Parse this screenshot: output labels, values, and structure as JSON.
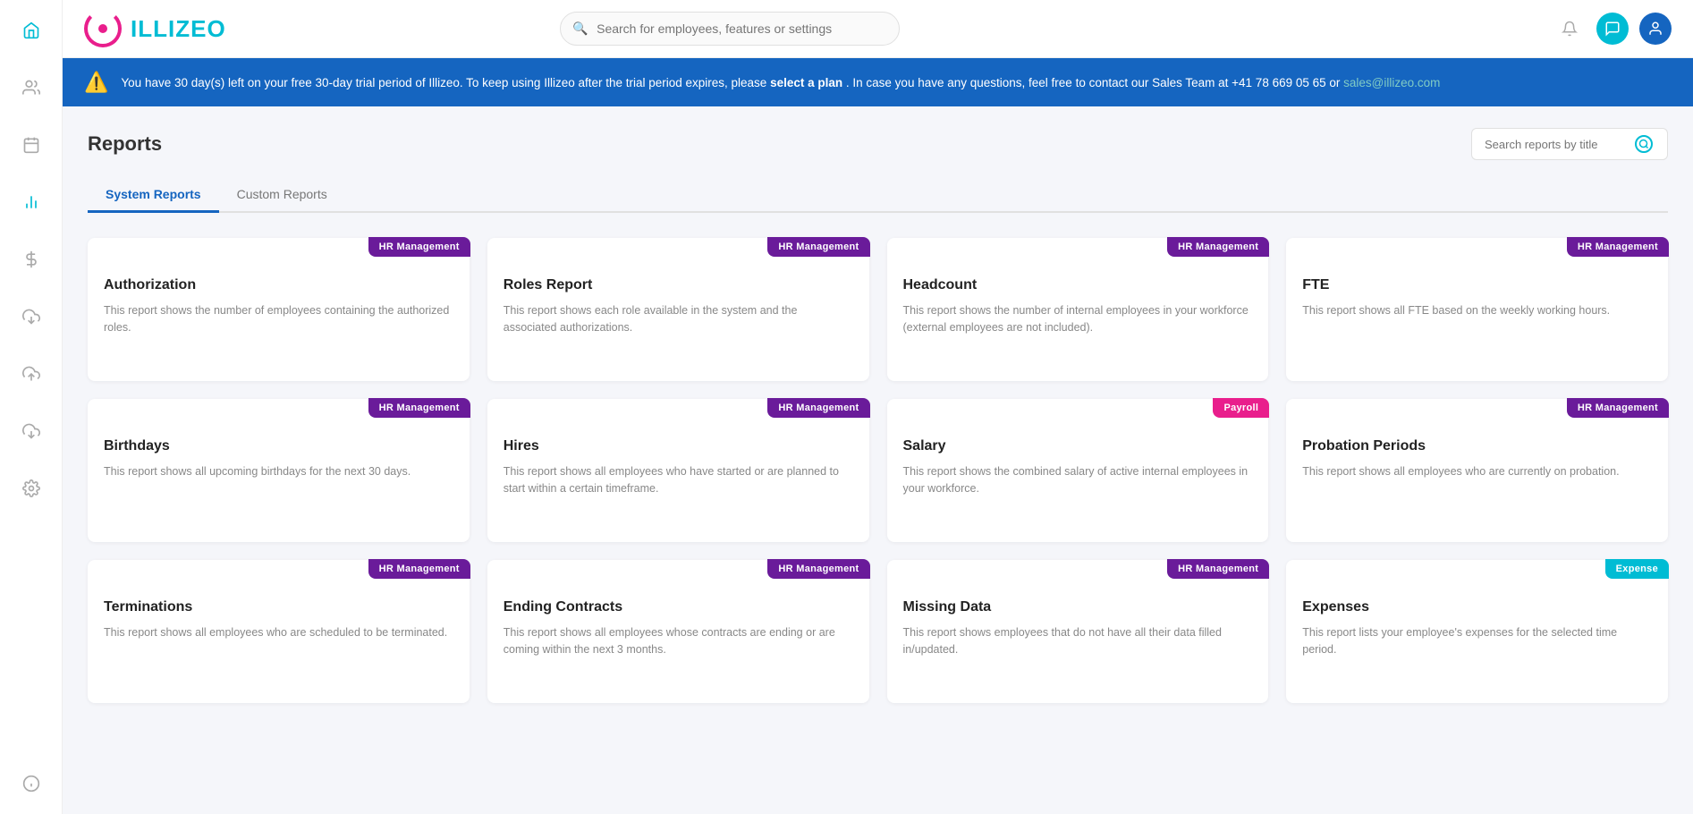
{
  "logo": {
    "text": "ILLIZE",
    "accent_char": "O"
  },
  "topbar": {
    "search_placeholder": "Search for employees, features or settings"
  },
  "trial_banner": {
    "message_start": "You have 30 day(s) left on your free 30-day trial period of Illizeo. To keep using Illizeo after the trial period expires, please",
    "link_text": "select a plan",
    "message_end": ". In case you have any questions, feel free to contact our Sales Team at +41 78 669 05 65 or",
    "email": "sales@illizeo.com"
  },
  "page": {
    "title": "Reports",
    "search_placeholder": "Search reports by title"
  },
  "tabs": [
    {
      "label": "System Reports",
      "active": true
    },
    {
      "label": "Custom Reports",
      "active": false
    }
  ],
  "reports": [
    {
      "title": "Authorization",
      "badge": "HR Management",
      "badge_type": "hr",
      "description": "This report shows the number of employees containing the authorized roles."
    },
    {
      "title": "Roles Report",
      "badge": "HR Management",
      "badge_type": "hr",
      "description": "This report shows each role available in the system and the associated authorizations."
    },
    {
      "title": "Headcount",
      "badge": "HR Management",
      "badge_type": "hr",
      "description": "This report shows the number of internal employees in your workforce (external employees are not included)."
    },
    {
      "title": "FTE",
      "badge": "HR Management",
      "badge_type": "hr",
      "description": "This report shows all FTE based on the weekly working hours."
    },
    {
      "title": "Birthdays",
      "badge": "HR Management",
      "badge_type": "hr",
      "description": "This report shows all upcoming birthdays for the next 30 days."
    },
    {
      "title": "Hires",
      "badge": "HR Management",
      "badge_type": "hr",
      "description": "This report shows all employees who have started or are planned to start within a certain timeframe."
    },
    {
      "title": "Salary",
      "badge": "Payroll",
      "badge_type": "payroll",
      "description": "This report shows the combined salary of active internal employees in your workforce."
    },
    {
      "title": "Probation Periods",
      "badge": "HR Management",
      "badge_type": "hr",
      "description": "This report shows all employees who are currently on probation."
    },
    {
      "title": "Terminations",
      "badge": "HR Management",
      "badge_type": "hr",
      "description": "This report shows all employees who are scheduled to be terminated."
    },
    {
      "title": "Ending Contracts",
      "badge": "HR Management",
      "badge_type": "hr",
      "description": "This report shows all employees whose contracts are ending or are coming within the next 3 months."
    },
    {
      "title": "Missing Data",
      "badge": "HR Management",
      "badge_type": "hr",
      "description": "This report shows employees that do not have all their data filled in/updated."
    },
    {
      "title": "Expenses",
      "badge": "Expense",
      "badge_type": "expense",
      "description": "This report lists your employee's expenses for the selected time period."
    }
  ],
  "sidebar": {
    "items": [
      {
        "icon": "🏠",
        "name": "home-icon",
        "active": false
      },
      {
        "icon": "👥",
        "name": "employees-icon",
        "active": false
      },
      {
        "icon": "📅",
        "name": "calendar-icon",
        "active": false
      },
      {
        "icon": "📊",
        "name": "reports-icon",
        "active": true
      },
      {
        "icon": "💲",
        "name": "payroll-icon",
        "active": false
      },
      {
        "icon": "⬇️",
        "name": "download-icon",
        "active": false
      },
      {
        "icon": "☁️",
        "name": "cloud-upload-icon",
        "active": false
      },
      {
        "icon": "⬇️",
        "name": "cloud-download-icon",
        "active": false
      },
      {
        "icon": "⚙️",
        "name": "settings-icon",
        "active": false
      }
    ],
    "bottom_items": [
      {
        "icon": "ℹ️",
        "name": "info-icon"
      }
    ]
  }
}
